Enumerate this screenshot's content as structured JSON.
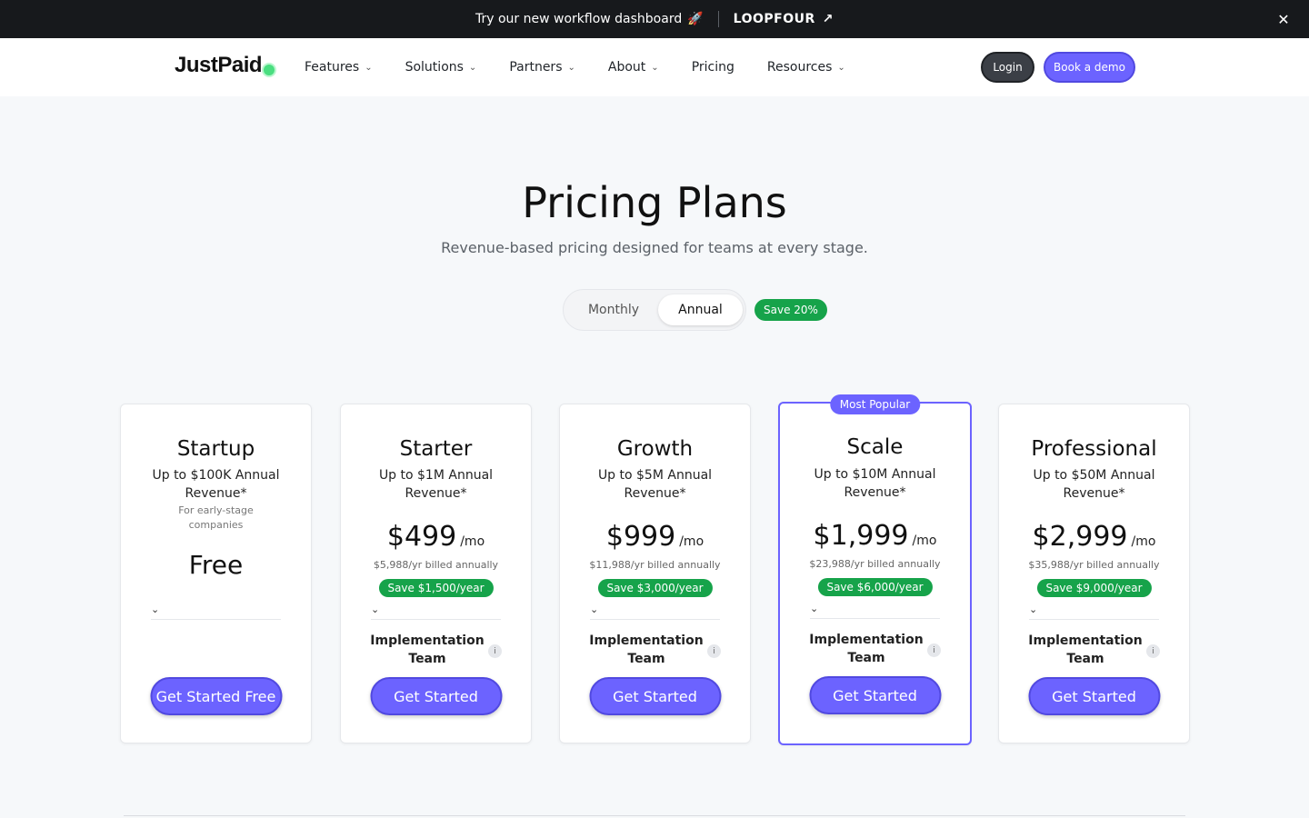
{
  "announcement": {
    "text": "Try our new workflow dashboard",
    "emoji": "🚀",
    "link_label": "LOOPFOUR",
    "link_icon": "↗",
    "close_icon": "✕"
  },
  "nav": {
    "logo": "JustPaid",
    "items": [
      {
        "label": "Features",
        "has_dropdown": true
      },
      {
        "label": "Solutions",
        "has_dropdown": true
      },
      {
        "label": "Partners",
        "has_dropdown": true
      },
      {
        "label": "About",
        "has_dropdown": true
      },
      {
        "label": "Pricing",
        "has_dropdown": false
      },
      {
        "label": "Resources",
        "has_dropdown": true
      }
    ],
    "chevron": "⌄",
    "login_label": "Login",
    "demo_label": "Book a demo"
  },
  "hero": {
    "title": "Pricing Plans",
    "subtitle": "Revenue-based pricing designed for teams at every stage."
  },
  "billing_toggle": {
    "monthly_label": "Monthly",
    "annual_label": "Annual",
    "selected": "Annual",
    "save_badge": "Save 20%"
  },
  "plans": [
    {
      "name": "Startup",
      "revenue": "Up to $100K Annual Revenue*",
      "description": "For early-stage companies",
      "price": "Free",
      "cta": "Get Started Free"
    },
    {
      "name": "Starter",
      "revenue": "Up to $1M Annual Revenue*",
      "price": "$499",
      "per": "/mo",
      "billed": "$5,988/yr billed annually",
      "savings": "Save $1,500/year",
      "feature": "Implementation Team",
      "cta": "Get Started"
    },
    {
      "name": "Growth",
      "revenue": "Up to $5M Annual Revenue*",
      "price": "$999",
      "per": "/mo",
      "billed": "$11,988/yr billed annually",
      "savings": "Save $3,000/year",
      "feature": "Implementation Team",
      "cta": "Get Started"
    },
    {
      "name": "Scale",
      "badge": "Most Popular",
      "revenue": "Up to $10M Annual Revenue*",
      "price": "$1,999",
      "per": "/mo",
      "billed": "$23,988/yr billed annually",
      "savings": "Save $6,000/year",
      "feature": "Implementation Team",
      "cta": "Get Started"
    },
    {
      "name": "Professional",
      "revenue": "Up to $50M Annual Revenue*",
      "price": "$2,999",
      "per": "/mo",
      "billed": "$35,988/yr billed annually",
      "savings": "Save $9,000/year",
      "feature": "Implementation Team",
      "cta": "Get Started"
    }
  ],
  "icons": {
    "info": "i",
    "dropdown": "⌄"
  },
  "colors": {
    "accent": "#6c63ff",
    "success": "#16a34a",
    "dark": "#17191c"
  }
}
